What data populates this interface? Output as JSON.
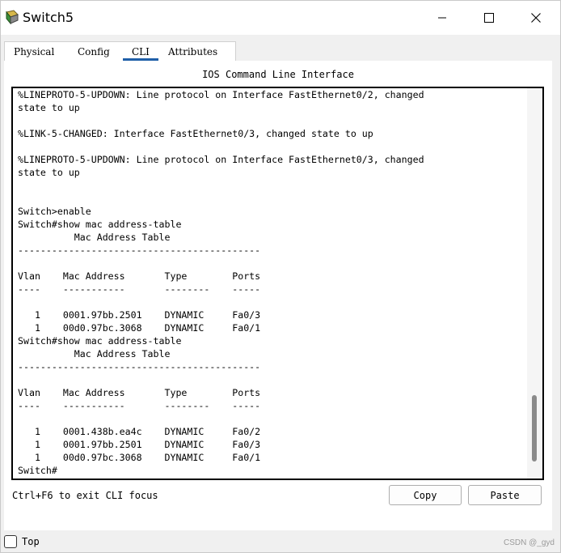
{
  "window": {
    "title": "Switch5",
    "icon": "packet-tracer-switch-icon",
    "controls": [
      "minimize-icon",
      "maximize-icon",
      "close-icon"
    ]
  },
  "tabs": [
    {
      "label": "Physical",
      "selected": false
    },
    {
      "label": "Config",
      "selected": false
    },
    {
      "label": "CLI",
      "selected": true
    },
    {
      "label": "Attributes",
      "selected": false
    }
  ],
  "cli": {
    "heading": "IOS Command Line Interface",
    "lines": [
      "%LINEPROTO-5-UPDOWN: Line protocol on Interface FastEthernet0/2, changed",
      "state to up",
      "",
      "%LINK-5-CHANGED: Interface FastEthernet0/3, changed state to up",
      "",
      "%LINEPROTO-5-UPDOWN: Line protocol on Interface FastEthernet0/3, changed",
      "state to up",
      "",
      "",
      "Switch>enable",
      "Switch#show mac address-table",
      "          Mac Address Table",
      "-------------------------------------------",
      "",
      "Vlan    Mac Address       Type        Ports",
      "----    -----------       --------    -----",
      "",
      "   1    0001.97bb.2501    DYNAMIC     Fa0/3",
      "   1    00d0.97bc.3068    DYNAMIC     Fa0/1",
      "Switch#show mac address-table",
      "          Mac Address Table",
      "-------------------------------------------",
      "",
      "Vlan    Mac Address       Type        Ports",
      "----    -----------       --------    -----",
      "",
      "   1    0001.438b.ea4c    DYNAMIC     Fa0/2",
      "   1    0001.97bb.2501    DYNAMIC     Fa0/3",
      "   1    00d0.97bc.3068    DYNAMIC     Fa0/1",
      "Switch#"
    ]
  },
  "footer": {
    "hint": "Ctrl+F6 to exit CLI focus",
    "copy_label": "Copy",
    "paste_label": "Paste",
    "top_label": "Top",
    "top_checked": false,
    "watermark": "CSDN @_gyd"
  },
  "colors": {
    "tab_underline": "#1f5fa8",
    "terminal_border": "#000000",
    "scroll_thumb": "#8a8a8a"
  }
}
